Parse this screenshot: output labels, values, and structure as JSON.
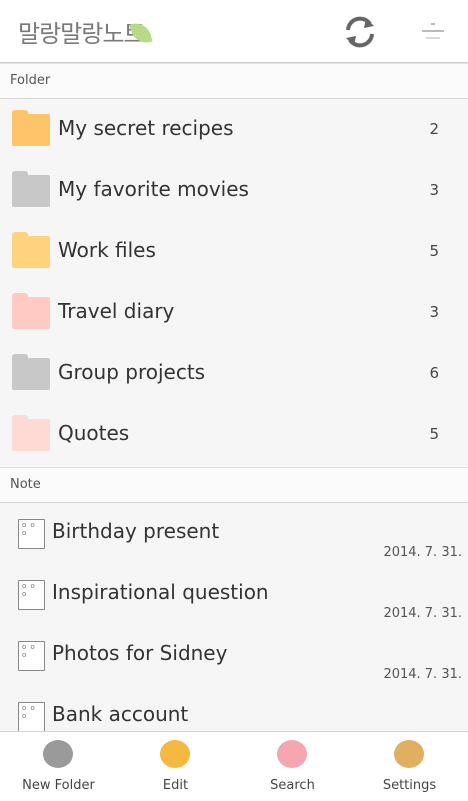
{
  "header": {
    "logo_text": "말랑말랑노트",
    "sync_icon": "sync-icon",
    "menu_icon": "menu-icon"
  },
  "folder_section": {
    "title": "Folder"
  },
  "folders": [
    {
      "name": "My secret recipes",
      "count": "2",
      "icon": "lion-folder-icon",
      "color": "#ffc46a"
    },
    {
      "name": "My favorite movies",
      "count": "3",
      "icon": "cat-folder-icon",
      "color": "#c8c8c8"
    },
    {
      "name": "Work files",
      "count": "5",
      "icon": "dog-folder-icon",
      "color": "#ffd27d"
    },
    {
      "name": "Travel diary",
      "count": "3",
      "icon": "pig-folder-icon",
      "color": "#ffc9c4"
    },
    {
      "name": "Group projects",
      "count": "6",
      "icon": "cat-folder-icon",
      "color": "#c8c8c8"
    },
    {
      "name": "Quotes",
      "count": "5",
      "icon": "rabbit-folder-icon",
      "color": "#ffd9d4"
    }
  ],
  "note_section": {
    "title": "Note"
  },
  "notes": [
    {
      "title": "Birthday present",
      "date": "2014. 7. 31."
    },
    {
      "title": "Inspirational question",
      "date": "2014. 7. 31."
    },
    {
      "title": "Photos for Sidney",
      "date": "2014. 7. 31."
    },
    {
      "title": "Bank account",
      "date": ""
    }
  ],
  "bottom_nav": [
    {
      "label": "New Folder",
      "icon": "cat-icon",
      "color": "#9a9a9a"
    },
    {
      "label": "Edit",
      "icon": "lion-icon",
      "color": "#f5b942"
    },
    {
      "label": "Search",
      "icon": "pig-icon",
      "color": "#f5a6b0"
    },
    {
      "label": "Settings",
      "icon": "dog-icon",
      "color": "#e0b060"
    }
  ]
}
